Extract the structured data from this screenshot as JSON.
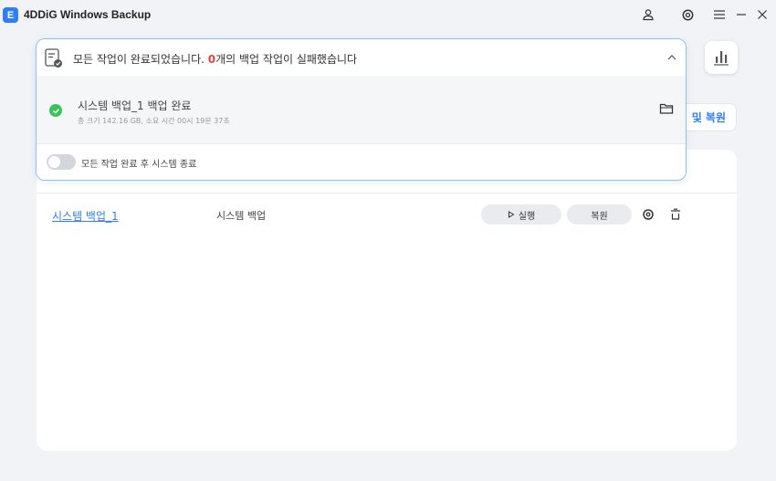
{
  "app": {
    "title": "4DDiG Windows Backup",
    "logo_letter": "E"
  },
  "titlebar": {
    "icons": [
      "user-icon",
      "settings-icon",
      "menu-icon",
      "minimize-icon",
      "close-icon"
    ]
  },
  "popup": {
    "message_before": "모든 작업이 완료되었습니다. ",
    "failed_count": "0",
    "message_after": "개의 백업 작업이 실패했습니다",
    "task": {
      "name": "시스템 백업_1 백업 완료",
      "details": "총 크기 142.16 GB, 소요 시간 00시 19분 37초"
    },
    "shutdown_toggle_label": "모든 작업 완료 후 시스템 종료",
    "shutdown_enabled": false
  },
  "toolbar": {
    "backup_restore_label": "및 복원"
  },
  "backup_list": [
    {
      "name": "시스템 백업_1",
      "type": "시스템 백업",
      "run_label": "실행",
      "restore_label": "복원"
    }
  ],
  "colors": {
    "accent": "#2f7ef5",
    "fail": "#e84343",
    "success": "#3cc25a"
  }
}
